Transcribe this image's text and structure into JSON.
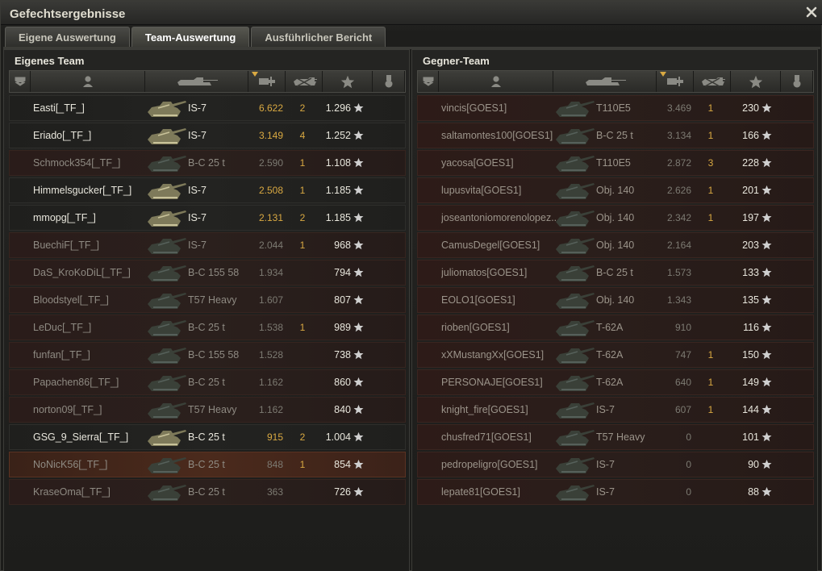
{
  "window": {
    "title": "Gefechtsergebnisse"
  },
  "tabs": [
    {
      "label": "Eigene Auswertung",
      "active": false
    },
    {
      "label": "Team-Auswertung",
      "active": true
    },
    {
      "label": "Ausführlicher Bericht",
      "active": false
    }
  ],
  "colors": {
    "accent": "#d9a942",
    "text": "#e8e6dc",
    "dim": "#8e8a82"
  },
  "left_team": {
    "title": "Eigenes Team",
    "rows": [
      {
        "name": "Easti[_TF_]",
        "tank": "IS-7",
        "damage": "6.622",
        "kills": "2",
        "xp": "1.296",
        "state": "alive"
      },
      {
        "name": "Eriado[_TF_]",
        "tank": "IS-7",
        "damage": "3.149",
        "kills": "4",
        "xp": "1.252",
        "state": "alive"
      },
      {
        "name": "Schmock354[_TF_]",
        "tank": "B-C 25 t",
        "damage": "2.590",
        "kills": "1",
        "xp": "1.108",
        "state": "dead"
      },
      {
        "name": "Himmelsgucker[_TF_]",
        "tank": "IS-7",
        "damage": "2.508",
        "kills": "1",
        "xp": "1.185",
        "state": "alive"
      },
      {
        "name": "mmopg[_TF_]",
        "tank": "IS-7",
        "damage": "2.131",
        "kills": "2",
        "xp": "1.185",
        "state": "alive"
      },
      {
        "name": "BuechiF[_TF_]",
        "tank": "IS-7",
        "damage": "2.044",
        "kills": "1",
        "xp": "968",
        "state": "dead"
      },
      {
        "name": "DaS_KroKoDiL[_TF_]",
        "tank": "B-C 155 58",
        "damage": "1.934",
        "kills": "",
        "xp": "794",
        "state": "dead"
      },
      {
        "name": "Bloodstyel[_TF_]",
        "tank": "T57 Heavy",
        "damage": "1.607",
        "kills": "",
        "xp": "807",
        "state": "dead"
      },
      {
        "name": "LeDuc[_TF_]",
        "tank": "B-C 25 t",
        "damage": "1.538",
        "kills": "1",
        "xp": "989",
        "state": "dead"
      },
      {
        "name": "funfan[_TF_]",
        "tank": "B-C 155 58",
        "damage": "1.528",
        "kills": "",
        "xp": "738",
        "state": "dead"
      },
      {
        "name": "Papachen86[_TF_]",
        "tank": "B-C 25 t",
        "damage": "1.162",
        "kills": "",
        "xp": "860",
        "state": "dead"
      },
      {
        "name": "norton09[_TF_]",
        "tank": "T57 Heavy",
        "damage": "1.162",
        "kills": "",
        "xp": "840",
        "state": "dead"
      },
      {
        "name": "GSG_9_Sierra[_TF_]",
        "tank": "B-C 25 t",
        "damage": "915",
        "kills": "2",
        "xp": "1.004",
        "state": "alive"
      },
      {
        "name": "NoNicK56[_TF_]",
        "tank": "B-C 25 t",
        "damage": "848",
        "kills": "1",
        "xp": "854",
        "state": "player"
      },
      {
        "name": "KraseOma[_TF_]",
        "tank": "B-C 25 t",
        "damage": "363",
        "kills": "",
        "xp": "726",
        "state": "dead"
      }
    ]
  },
  "right_team": {
    "title": "Gegner-Team",
    "rows": [
      {
        "name": "vincis[GOES1]",
        "tank": "T110E5",
        "damage": "3.469",
        "kills": "1",
        "xp": "230"
      },
      {
        "name": "saltamontes100[GOES1]",
        "tank": "B-C 25 t",
        "damage": "3.134",
        "kills": "1",
        "xp": "166"
      },
      {
        "name": "yacosa[GOES1]",
        "tank": "T110E5",
        "damage": "2.872",
        "kills": "3",
        "xp": "228"
      },
      {
        "name": "lupusvita[GOES1]",
        "tank": "Obj. 140",
        "damage": "2.626",
        "kills": "1",
        "xp": "201"
      },
      {
        "name": "joseantoniomorenolopez..",
        "tank": "Obj. 140",
        "damage": "2.342",
        "kills": "1",
        "xp": "197"
      },
      {
        "name": "CamusDegel[GOES1]",
        "tank": "Obj. 140",
        "damage": "2.164",
        "kills": "",
        "xp": "203"
      },
      {
        "name": "juliomatos[GOES1]",
        "tank": "B-C 25 t",
        "damage": "1.573",
        "kills": "",
        "xp": "133"
      },
      {
        "name": "EOLO1[GOES1]",
        "tank": "Obj. 140",
        "damage": "1.343",
        "kills": "",
        "xp": "135"
      },
      {
        "name": "rioben[GOES1]",
        "tank": "T-62A",
        "damage": "910",
        "kills": "",
        "xp": "116"
      },
      {
        "name": "xXMustangXx[GOES1]",
        "tank": "T-62A",
        "damage": "747",
        "kills": "1",
        "xp": "150"
      },
      {
        "name": "PERSONAJE[GOES1]",
        "tank": "T-62A",
        "damage": "640",
        "kills": "1",
        "xp": "149"
      },
      {
        "name": "knight_fire[GOES1]",
        "tank": "IS-7",
        "damage": "607",
        "kills": "1",
        "xp": "144"
      },
      {
        "name": "chusfred71[GOES1]",
        "tank": "T57 Heavy",
        "damage": "0",
        "kills": "",
        "xp": "101"
      },
      {
        "name": "pedropeligro[GOES1]",
        "tank": "IS-7",
        "damage": "0",
        "kills": "",
        "xp": "90"
      },
      {
        "name": "lepate81[GOES1]",
        "tank": "IS-7",
        "damage": "0",
        "kills": "",
        "xp": "88"
      }
    ]
  }
}
